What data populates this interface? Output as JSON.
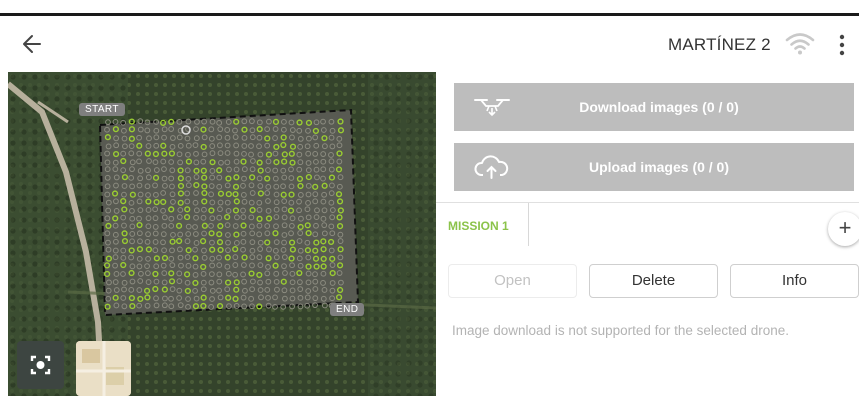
{
  "header": {
    "back_icon": "arrow-left-icon",
    "title": "MARTÍNEZ 2",
    "wifi_icon": "wifi-icon",
    "menu_icon": "more-vert-icon"
  },
  "map": {
    "start_label": "START",
    "end_label": "END",
    "recenter_icon": "recenter-icon",
    "layer_icon": "map-layer-thumbnail"
  },
  "actions": {
    "download_label": "Download images (0 / 0)",
    "download_icon": "drone-icon",
    "upload_label": "Upload images (0 / 0)",
    "upload_icon": "cloud-upload-icon"
  },
  "missions": {
    "tabs": [
      {
        "label": "MISSION 1"
      }
    ],
    "add_label": "+"
  },
  "buttons": {
    "open": "Open",
    "delete": "Delete",
    "info": "Info"
  },
  "note": "Image download is not supported for the selected drone.",
  "colors": {
    "accent": "#8bc34a",
    "action_bg": "#bdbdbd",
    "map_bg": "#3b4a30"
  }
}
